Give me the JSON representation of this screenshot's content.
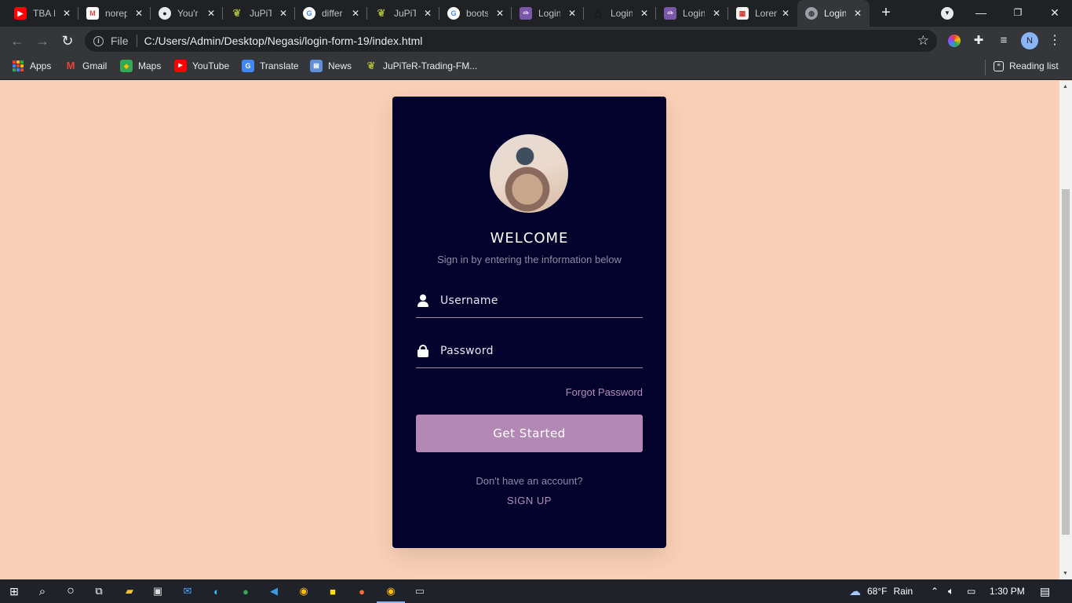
{
  "browser": {
    "tabs": [
      {
        "title": "TBA I",
        "favicon": "youtube-icon",
        "color": "#ff0000"
      },
      {
        "title": "norep",
        "favicon": "gmail-icon",
        "color": "#ea4335"
      },
      {
        "title": "You'r",
        "favicon": "github-icon",
        "color": "#e8eaed"
      },
      {
        "title": "JuPiTe",
        "favicon": "leaf-icon",
        "color": "#a3b13a"
      },
      {
        "title": "differ",
        "favicon": "google-icon",
        "color": "#4285f4"
      },
      {
        "title": "JuPiTe",
        "favicon": "leaf-icon",
        "color": "#a3b13a"
      },
      {
        "title": "boots",
        "favicon": "google-icon",
        "color": "#4285f4"
      },
      {
        "title": "Login",
        "favicon": "colorlib-icon",
        "color": "#7b57a8"
      },
      {
        "title": "Login",
        "favicon": "house-icon",
        "color": "#111111"
      },
      {
        "title": "Login",
        "favicon": "colorlib-icon",
        "color": "#7b57a8"
      },
      {
        "title": "Lorem",
        "favicon": "store-icon",
        "color": "#d83b3b"
      },
      {
        "title": "Login",
        "favicon": "globe-icon",
        "color": "#9aa0a6"
      }
    ],
    "url_scheme": "File",
    "url": "C:/Users/Admin/Desktop/Negasi/login-form-19/index.html",
    "profile_initial": "N",
    "bookmarks": [
      {
        "label": "Apps",
        "icon": "apps-grid-icon"
      },
      {
        "label": "Gmail",
        "icon": "gmail-icon"
      },
      {
        "label": "Maps",
        "icon": "maps-icon"
      },
      {
        "label": "YouTube",
        "icon": "youtube-icon"
      },
      {
        "label": "Translate",
        "icon": "translate-icon"
      },
      {
        "label": "News",
        "icon": "news-icon"
      },
      {
        "label": "JuPiTeR-Trading-FM...",
        "icon": "leaf-icon"
      }
    ],
    "reading_list": "Reading list"
  },
  "page": {
    "background": "#fad1b6",
    "card_color": "#03022d",
    "accent": "#b388b4",
    "welcome": "WELCOME",
    "subtitle": "Sign in by entering the information below",
    "username_placeholder": "Username",
    "password_placeholder": "Password",
    "forgot": "Forgot Password",
    "cta": "Get Started",
    "no_account": "Don't have an account?",
    "signup": "SIGN UP"
  },
  "taskbar": {
    "weather_temp": "68°F",
    "weather_text": "Rain",
    "time": "1:30 PM"
  }
}
